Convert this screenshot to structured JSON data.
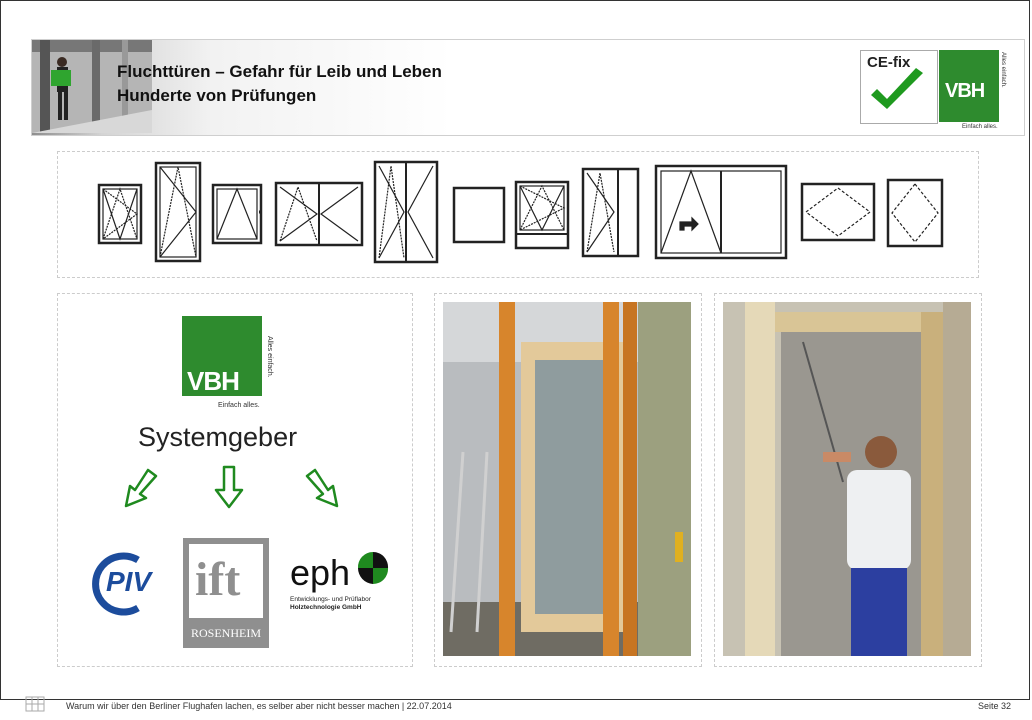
{
  "header": {
    "title_line1": "Fluchttüren – Gefahr für Leib und Leben",
    "title_line2": "Hunderte von Prüfungen"
  },
  "logos": {
    "cefix": "CE-fix",
    "vbh": "VBH",
    "vbh_side": "Alles einfach.",
    "vbh_foot": "Einfach alles."
  },
  "main": {
    "systemgeber": "Systemgeber",
    "partners": {
      "piv": "PIV",
      "ift": "ift",
      "ift_sub": "ROSENHEIM",
      "eph": "eph",
      "eph_sub1": "Entwicklungs- und Prüflabor",
      "eph_sub2": "Holztechnologie GmbH"
    }
  },
  "footer": {
    "text": "Warum wir über den Berliner Flughafen lachen, es selber aber nicht besser machen | 22.07.2014",
    "page": "Seite 32"
  },
  "colors": {
    "brand_green": "#2e8b2e",
    "arrow_green": "#1f8a1f",
    "piv_blue": "#1c4c9c",
    "ift_gray": "#8f8f8f"
  }
}
